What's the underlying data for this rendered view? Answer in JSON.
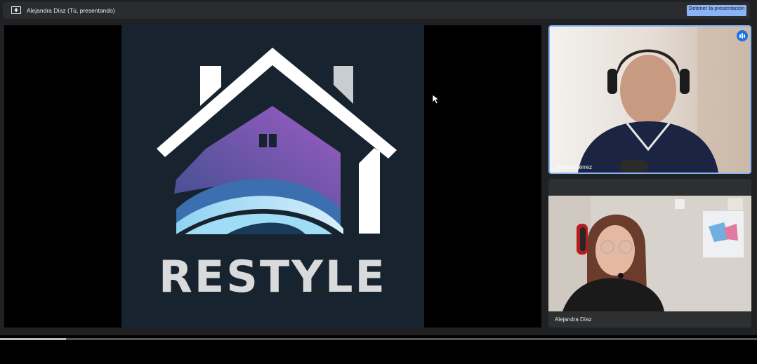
{
  "meeting": {
    "presenter_label": "Alejandra Díaz (Tú, presentando)",
    "stop_button_label": "Detener la presentación",
    "present_icon": "present-to-all-icon"
  },
  "shared_screen": {
    "brand_text": "RESTYLE",
    "logo_colors": {
      "background": "#17232e",
      "roof": "#ffffff",
      "house_purple": "#7a55b0",
      "wave_blue": "#7fc8ef"
    }
  },
  "participants": [
    {
      "name": "José Gutiérrez",
      "visible_name": "José Gutiérrez",
      "speaking": true
    },
    {
      "name": "Alejandra Díaz",
      "visible_name": "Alejandra Díaz",
      "speaking": false
    }
  ],
  "video_progress": {
    "fraction": 0.087
  },
  "colors": {
    "accent": "#8ab4f8",
    "speaking_indicator": "#1a73e8"
  }
}
